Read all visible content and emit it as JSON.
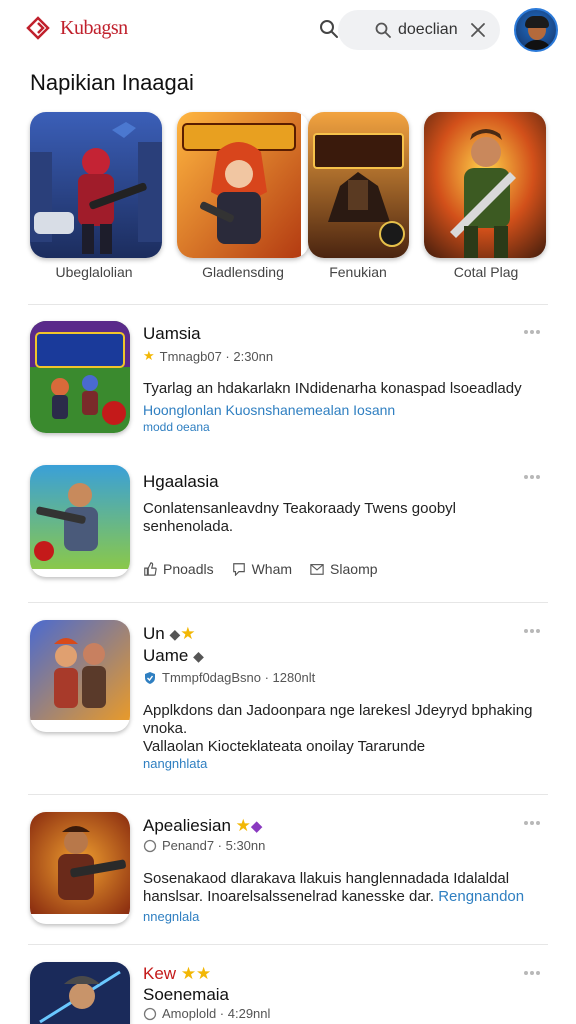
{
  "header": {
    "brand": "Kubagsn",
    "search_text": "doeclian"
  },
  "section_title": "Napikian Inaagai",
  "featured": [
    {
      "label": "Ubeglalolian"
    },
    {
      "label": "Gladlensding"
    },
    {
      "label": "Fenukian"
    },
    {
      "label": "Cotal Plag"
    }
  ],
  "feed": [
    {
      "title": "Uamsia",
      "meta": "Tmnagb07 · 2:30nn",
      "desc": "Tyarlag an hdakarlakn INdidenarha konaspad lsoeadlady",
      "link1": "Hoonglonlan Kuosnshanemealan Iosann",
      "link2": "modd oeana"
    },
    {
      "title": "Hgaalasia",
      "desc": "Conlatensanleavdny Teakoraady Twens goobyl senhenolada.",
      "actions": [
        "Pnoadls",
        "Wham",
        "Slaomp"
      ]
    },
    {
      "title_line1": "Un",
      "title_line2": "Uame",
      "meta": "Tmmpf0dagBsno · 1280nlt",
      "desc1": "Applkdons dan Jadoonpara nge larekesl Jdeyryd bphaking vnoka.",
      "desc2": "Vallaolan Kiocteklateata onoilay Tararunde",
      "link": "nangnhlata"
    },
    {
      "title": "Apealiesian",
      "meta": "Penand7 · 5:30nn",
      "desc": "Sosenakaod dlarakava llakuis hanglennadada Idalaldal hanslsar. Inoarelsalssenelrad kanesske dar.",
      "link_inline": "Rengnandon",
      "link": "nnegnlala"
    },
    {
      "title_line1": "Kew",
      "title_line2": "Soenemaia",
      "meta": "Amoplold · 4:29nnl"
    }
  ]
}
